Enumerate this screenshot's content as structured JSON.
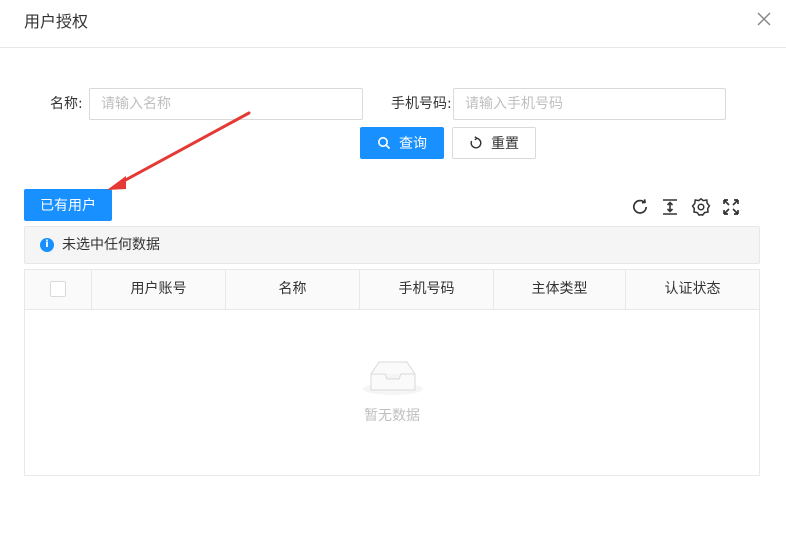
{
  "modal": {
    "title": "用户授权"
  },
  "search": {
    "name_label": "名称:",
    "name_placeholder": "请输入名称",
    "phone_label": "手机号码:",
    "phone_placeholder": "请输入手机号码",
    "query_label": "查询",
    "reset_label": "重置"
  },
  "toolbar": {
    "existing_users_label": "已有用户",
    "icons": [
      "refresh-icon",
      "column-height-icon",
      "setting-icon",
      "fullscreen-icon"
    ]
  },
  "alert": {
    "text": "未选中任何数据"
  },
  "table": {
    "columns": [
      "用户账号",
      "名称",
      "手机号码",
      "主体类型",
      "认证状态"
    ],
    "rows": [],
    "empty_text": "暂无数据"
  },
  "colors": {
    "primary": "#1890ff",
    "annotation_arrow": "#e53935"
  }
}
